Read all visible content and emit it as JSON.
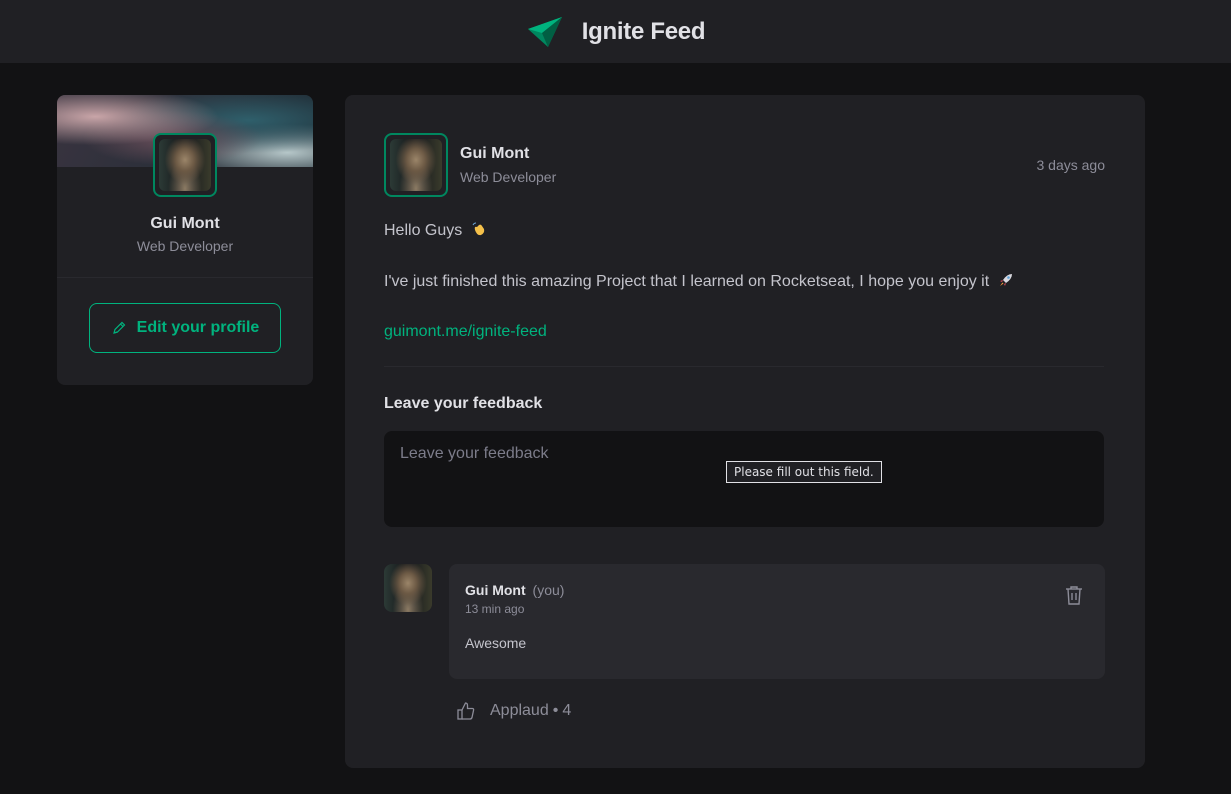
{
  "header": {
    "title": "Ignite Feed"
  },
  "sidebar": {
    "name": "Gui Mont",
    "role": "Web Developer",
    "edit_button": "Edit your profile"
  },
  "post": {
    "author": {
      "name": "Gui Mont",
      "role": "Web Developer"
    },
    "time": "3 days ago",
    "greeting": "Hello Guys",
    "body": "I've just finished this amazing Project that I learned on Rocketseat, I hope you enjoy it",
    "link": "guimont.me/ignite-feed"
  },
  "feedback": {
    "title": "Leave your feedback",
    "placeholder": "Leave your feedback",
    "tooltip": "Please fill out this field."
  },
  "comment": {
    "author": "Gui Mont",
    "you_label": "(you)",
    "time": "13 min ago",
    "text": "Awesome",
    "applaud_label": "Applaud",
    "applaud_count": "4"
  },
  "colors": {
    "accent": "#00b37e",
    "accent_dark": "#00875f",
    "background": "#121214",
    "surface": "#202024"
  }
}
